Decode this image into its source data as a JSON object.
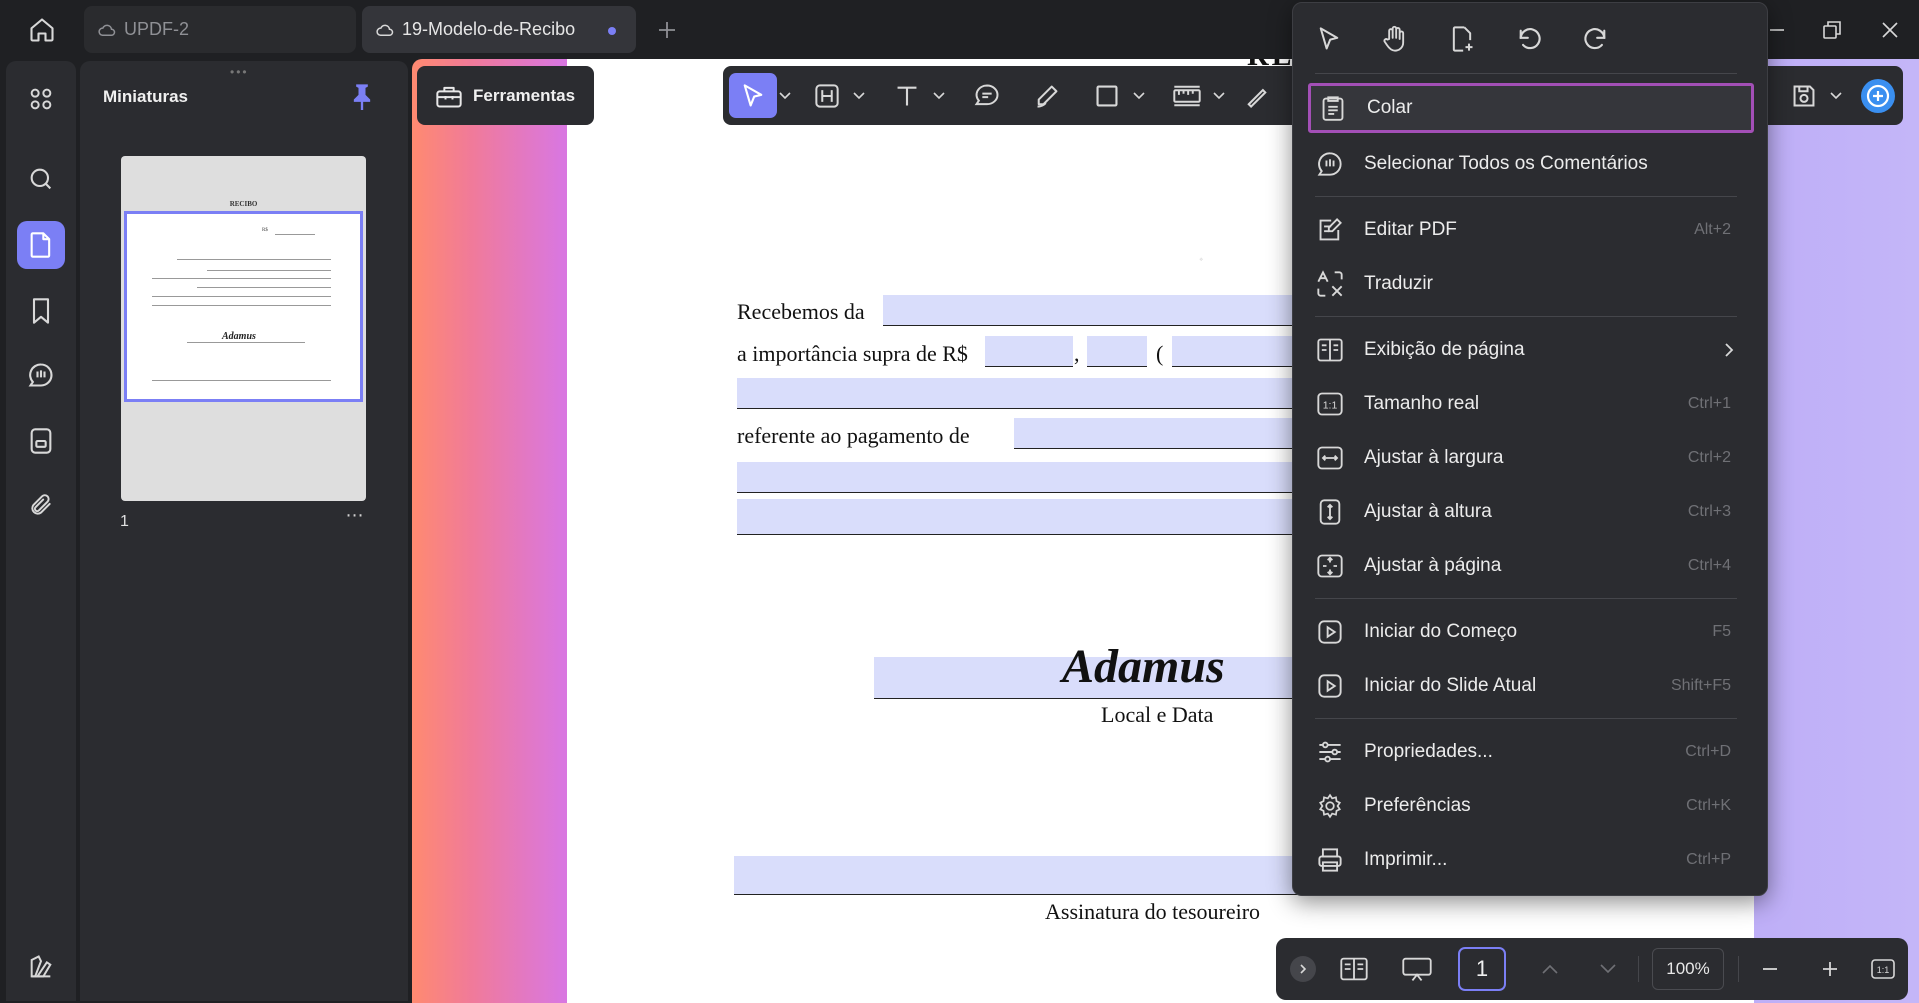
{
  "window": {
    "tabs": [
      {
        "label": "UPDF-2",
        "active": false
      },
      {
        "label": "19-Modelo-de-Recibo",
        "active": true,
        "unsaved": true
      }
    ]
  },
  "sidebar": {
    "panel_title": "Miniaturas",
    "thumbnail": {
      "page_number": "1",
      "more": "⋯"
    }
  },
  "toolbar": {
    "tools_label": "Ferramentas"
  },
  "document": {
    "title": "RECIBO",
    "lines": {
      "recebemos": "Recebemos da",
      "importancia": "a importância supra de R$",
      "comma": ",",
      "paren": "(",
      "referente": "referente ao pagamento de"
    },
    "signature": "Adamus",
    "local_data": "Local e Data",
    "assinatura": "Assinatura do tesoureiro",
    "thumb_title": "RECIBO",
    "thumb_rs": "R$"
  },
  "context_menu": {
    "items": [
      {
        "label": "Colar",
        "shortcut": "",
        "icon": "paste-icon",
        "highlighted": true
      },
      {
        "label": "Selecionar Todos os Comentários",
        "shortcut": "",
        "icon": "select-comments-icon"
      },
      {
        "label": "Editar PDF",
        "shortcut": "Alt+2",
        "icon": "edit-pdf-icon"
      },
      {
        "label": "Traduzir",
        "shortcut": "",
        "icon": "translate-icon"
      },
      {
        "label": "Exibição de página",
        "shortcut": "",
        "icon": "page-display-icon",
        "submenu": true
      },
      {
        "label": "Tamanho real",
        "shortcut": "Ctrl+1",
        "icon": "actual-size-icon"
      },
      {
        "label": "Ajustar à largura",
        "shortcut": "Ctrl+2",
        "icon": "fit-width-icon"
      },
      {
        "label": "Ajustar à altura",
        "shortcut": "Ctrl+3",
        "icon": "fit-height-icon"
      },
      {
        "label": "Ajustar à página",
        "shortcut": "Ctrl+4",
        "icon": "fit-page-icon"
      },
      {
        "label": "Iniciar do Começo",
        "shortcut": "F5",
        "icon": "play-start-icon"
      },
      {
        "label": "Iniciar do Slide Atual",
        "shortcut": "Shift+F5",
        "icon": "play-current-icon"
      },
      {
        "label": "Propriedades...",
        "shortcut": "Ctrl+D",
        "icon": "properties-icon"
      },
      {
        "label": "Preferências",
        "shortcut": "Ctrl+K",
        "icon": "gear-icon"
      },
      {
        "label": "Imprimir...",
        "shortcut": "Ctrl+P",
        "icon": "printer-icon"
      }
    ],
    "fit_icon_text": "1:1"
  },
  "page_nav": {
    "current_page": "1",
    "zoom": "100%",
    "actual_size_label": "1:1"
  },
  "colors": {
    "accent": "#7b7ff5",
    "highlight_border": "#a34fb6",
    "form_field": "#d9ddfb",
    "panel_bg": "#2b2c30"
  }
}
